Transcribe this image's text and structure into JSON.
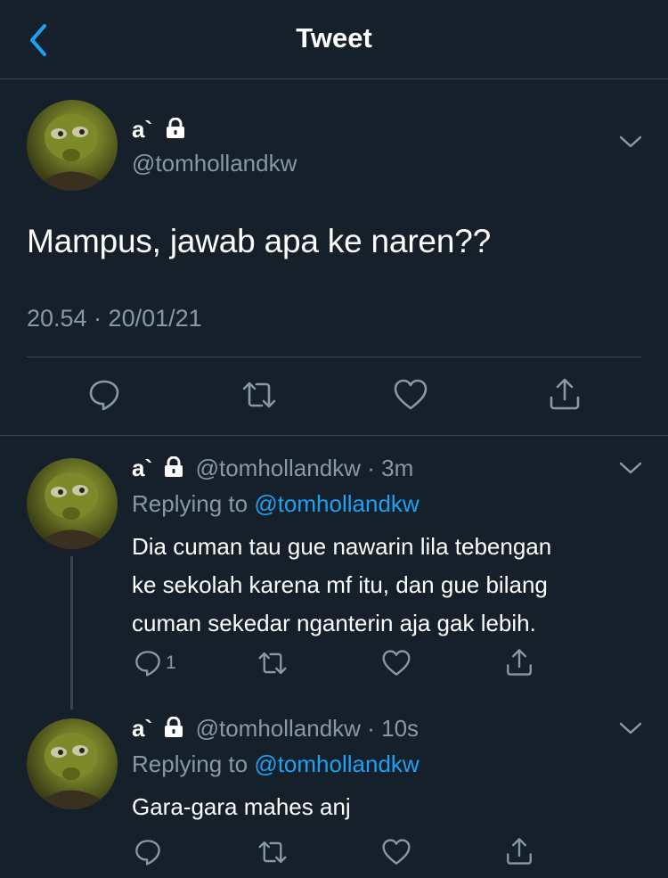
{
  "header": {
    "title": "Tweet"
  },
  "main_tweet": {
    "name": "a`",
    "handle": "@tomhollandkw",
    "text": "Mampus, jawab apa ke naren??",
    "timestamp": "20.54 · 20/01/21"
  },
  "replies": [
    {
      "name": "a`",
      "handle": "@tomhollandkw",
      "sep": "·",
      "time": "3m",
      "replying_prefix": "Replying to",
      "replying_to": "@tomhollandkw",
      "text_lines": [
        "Dia cuman tau gue nawarin lila tebengan",
        "ke sekolah karena mf itu, dan gue bilang",
        "cuman sekedar nganterin aja gak lebih."
      ],
      "reply_count": "1"
    },
    {
      "name": "a`",
      "handle": "@tomhollandkw",
      "sep": "·",
      "time": "10s",
      "replying_prefix": "Replying to",
      "replying_to": "@tomhollandkw",
      "text_lines": [
        "Gara-gara mahes anj"
      ],
      "reply_count": ""
    }
  ],
  "icons": {
    "back": "chevron-left-icon",
    "lock": "lock-icon",
    "more": "chevron-down-icon",
    "reply": "reply-icon",
    "retweet": "retweet-icon",
    "like": "heart-icon",
    "share": "share-icon"
  },
  "colors": {
    "background": "#15202b",
    "divider": "#38444d",
    "secondary_text": "#8899a6",
    "accent": "#1da1f2"
  }
}
